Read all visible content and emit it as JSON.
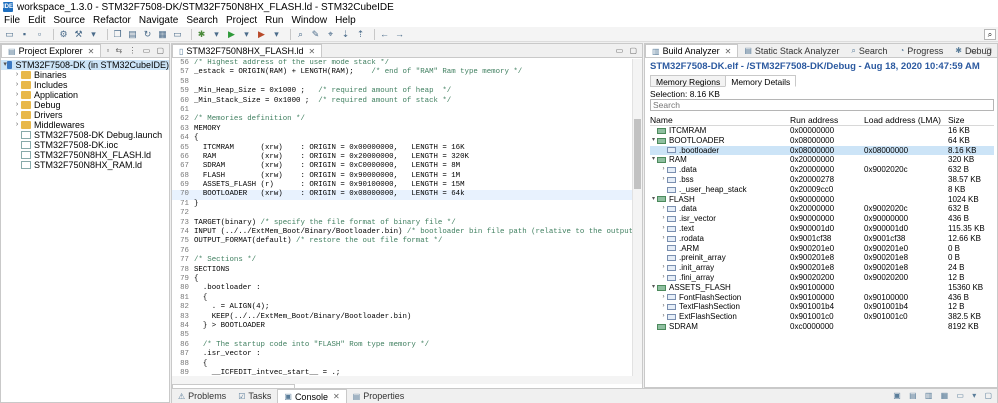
{
  "window": {
    "title": "workspace_1.3.0 - STM32F7508-DK/STM32F750N8HX_FLASH.ld - STM32CubeIDE",
    "icon": "IDE"
  },
  "menu": [
    "File",
    "Edit",
    "Source",
    "Refactor",
    "Navigate",
    "Search",
    "Project",
    "Run",
    "Window",
    "Help"
  ],
  "explorer": {
    "tab_label": "Project Explorer",
    "tree": [
      {
        "label": "STM32F7508-DK (in STM32CubeIDE)",
        "depth": 0,
        "expanded": true,
        "type": "project",
        "selected": true
      },
      {
        "label": "Binaries",
        "depth": 1,
        "type": "folder"
      },
      {
        "label": "Includes",
        "depth": 1,
        "type": "folder"
      },
      {
        "label": "Application",
        "depth": 1,
        "type": "folder"
      },
      {
        "label": "Debug",
        "depth": 1,
        "type": "folder"
      },
      {
        "label": "Drivers",
        "depth": 1,
        "type": "folder"
      },
      {
        "label": "Middlewares",
        "depth": 1,
        "type": "folder"
      },
      {
        "label": "STM32F7508-DK Debug.launch",
        "depth": 1,
        "type": "file"
      },
      {
        "label": "STM32F7508-DK.ioc",
        "depth": 1,
        "type": "file"
      },
      {
        "label": "STM32F750N8HX_FLASH.ld",
        "depth": 1,
        "type": "file"
      },
      {
        "label": "STM32F750N8HX_RAM.ld",
        "depth": 1,
        "type": "file"
      }
    ]
  },
  "editor": {
    "tab_label": "STM32F750N8HX_FLASH.ld",
    "bottom_tab": "STM32F750N8HX_FLASH.ld",
    "highlight_line": 70,
    "lines": [
      {
        "n": "56",
        "code": "/* Highest address of the user mode stack */"
      },
      {
        "n": "57",
        "code": "_estack = ORIGIN(RAM) + LENGTH(RAM);    /* end of \"RAM\" Ram type memory */"
      },
      {
        "n": "58",
        "code": ""
      },
      {
        "n": "59",
        "code": "_Min_Heap_Size = 0x1000 ;   /* required amount of heap  */"
      },
      {
        "n": "60",
        "code": "_Min_Stack_Size = 0x1000 ;  /* required amount of stack */"
      },
      {
        "n": "61",
        "code": ""
      },
      {
        "n": "62",
        "code": "/* Memories definition */"
      },
      {
        "n": "63",
        "code": "MEMORY"
      },
      {
        "n": "64",
        "code": "{"
      },
      {
        "n": "65",
        "code": "  ITCMRAM      (xrw)    : ORIGIN = 0x00000000,   LENGTH = 16K"
      },
      {
        "n": "66",
        "code": "  RAM          (xrw)    : ORIGIN = 0x20000000,   LENGTH = 320K"
      },
      {
        "n": "67",
        "code": "  SDRAM        (xrw)    : ORIGIN = 0xC0000000,   LENGTH = 8M"
      },
      {
        "n": "68",
        "code": "  FLASH        (xrw)    : ORIGIN = 0x90000000,   LENGTH = 1M"
      },
      {
        "n": "69",
        "code": "  ASSETS_FLASH (r)      : ORIGIN = 0x90100000,   LENGTH = 15M"
      },
      {
        "n": "70",
        "code": "  BOOTLOADER   (xrw)    : ORIGIN = 0x08000000,   LENGTH = 64k"
      },
      {
        "n": "71",
        "code": "}"
      },
      {
        "n": "72",
        "code": ""
      },
      {
        "n": "73",
        "code": "TARGET(binary) /* specify the file format of binary file */"
      },
      {
        "n": "74",
        "code": "INPUT (../../ExtMem_Boot/Binary/Bootloader.bin) /* bootloader bin file path (relative to the output folder)"
      },
      {
        "n": "75",
        "code": "OUTPUT_FORMAT(default) /* restore the out file format */"
      },
      {
        "n": "76",
        "code": ""
      },
      {
        "n": "77",
        "code": "/* Sections */"
      },
      {
        "n": "78",
        "code": "SECTIONS"
      },
      {
        "n": "79",
        "code": "{"
      },
      {
        "n": "80",
        "code": "  .bootloader :"
      },
      {
        "n": "81",
        "code": "  {"
      },
      {
        "n": "82",
        "code": "    . = ALIGN(4);"
      },
      {
        "n": "83",
        "code": "    KEEP(../../ExtMem_Boot/Binary/Bootloader.bin)"
      },
      {
        "n": "84",
        "code": "  } > BOOTLOADER"
      },
      {
        "n": "85",
        "code": ""
      },
      {
        "n": "86",
        "code": "  /* The startup code into \"FLASH\" Rom type memory */"
      },
      {
        "n": "87",
        "code": "  .isr_vector :"
      },
      {
        "n": "88",
        "code": "  {"
      },
      {
        "n": "89",
        "code": "    __ICFEDIT_intvec_start__ = .;"
      }
    ]
  },
  "analyzer": {
    "tabs": [
      "Build Analyzer",
      "Static Stack Analyzer",
      "Search",
      "Progress",
      "Debug"
    ],
    "title": "STM32F7508-DK.elf - /STM32F7508-DK/Debug - Aug 18, 2020 10:47:59 AM",
    "subtabs": [
      "Memory Regions",
      "Memory Details"
    ],
    "active_subtab": 1,
    "selection": "Selection: 8.16 KB",
    "search_placeholder": "Search",
    "columns": [
      "Name",
      "Run address (VMA)",
      "Load address (LMA)",
      "Size"
    ],
    "rows": [
      {
        "name": "ITCMRAM",
        "depth": 0,
        "kind": "region",
        "arrow": "",
        "vma": "0x00000000",
        "lma": "",
        "size": "16 KB"
      },
      {
        "name": "BOOTLOADER",
        "depth": 0,
        "kind": "region",
        "arrow": "▾",
        "vma": "0x08000000",
        "lma": "",
        "size": "64 KB"
      },
      {
        "name": ".bootloader",
        "depth": 1,
        "kind": "section",
        "arrow": "",
        "vma": "0x08000000",
        "lma": "0x08000000",
        "size": "8.16 KB",
        "selected": true
      },
      {
        "name": "RAM",
        "depth": 0,
        "kind": "region",
        "arrow": "▾",
        "vma": "0x20000000",
        "lma": "",
        "size": "320 KB"
      },
      {
        "name": ".data",
        "depth": 1,
        "kind": "section",
        "arrow": "›",
        "vma": "0x20000000",
        "lma": "0x9002020c",
        "size": "632 B"
      },
      {
        "name": ".bss",
        "depth": 1,
        "kind": "section",
        "arrow": "›",
        "vma": "0x20000278",
        "lma": "",
        "size": "38.57 KB"
      },
      {
        "name": "._user_heap_stack",
        "depth": 1,
        "kind": "section",
        "arrow": "",
        "vma": "0x20009cc0",
        "lma": "",
        "size": "8 KB"
      },
      {
        "name": "FLASH",
        "depth": 0,
        "kind": "region",
        "arrow": "▾",
        "vma": "0x90000000",
        "lma": "",
        "size": "1024 KB"
      },
      {
        "name": ".data",
        "depth": 1,
        "kind": "section",
        "arrow": "›",
        "vma": "0x20000000",
        "lma": "0x9002020c",
        "size": "632 B"
      },
      {
        "name": ".isr_vector",
        "depth": 1,
        "kind": "section",
        "arrow": "›",
        "vma": "0x90000000",
        "lma": "0x90000000",
        "size": "436 B"
      },
      {
        "name": ".text",
        "depth": 1,
        "kind": "section",
        "arrow": "›",
        "vma": "0x900001d0",
        "lma": "0x900001d0",
        "size": "115.35 KB"
      },
      {
        "name": ".rodata",
        "depth": 1,
        "kind": "section",
        "arrow": "›",
        "vma": "0x9001cf38",
        "lma": "0x9001cf38",
        "size": "12.66 KB"
      },
      {
        "name": ".ARM",
        "depth": 1,
        "kind": "section",
        "arrow": "",
        "vma": "0x900201e0",
        "lma": "0x900201e0",
        "size": "0 B"
      },
      {
        "name": ".preinit_array",
        "depth": 1,
        "kind": "section",
        "arrow": "",
        "vma": "0x900201e8",
        "lma": "0x900201e8",
        "size": "0 B"
      },
      {
        "name": ".init_array",
        "depth": 1,
        "kind": "section",
        "arrow": "›",
        "vma": "0x900201e8",
        "lma": "0x900201e8",
        "size": "24 B"
      },
      {
        "name": ".fini_array",
        "depth": 1,
        "kind": "section",
        "arrow": "›",
        "vma": "0x90020200",
        "lma": "0x90020200",
        "size": "12 B"
      },
      {
        "name": "ASSETS_FLASH",
        "depth": 0,
        "kind": "region",
        "arrow": "▾",
        "vma": "0x90100000",
        "lma": "",
        "size": "15360 KB"
      },
      {
        "name": "FontFlashSection",
        "depth": 1,
        "kind": "section",
        "arrow": "›",
        "vma": "0x90100000",
        "lma": "0x90100000",
        "size": "436 B"
      },
      {
        "name": "TextFlashSection",
        "depth": 1,
        "kind": "section",
        "arrow": "›",
        "vma": "0x901001b4",
        "lma": "0x901001b4",
        "size": "12 B"
      },
      {
        "name": "ExtFlashSection",
        "depth": 1,
        "kind": "section",
        "arrow": "›",
        "vma": "0x901001c0",
        "lma": "0x901001c0",
        "size": "382.5 KB"
      },
      {
        "name": "SDRAM",
        "depth": 0,
        "kind": "region",
        "arrow": "",
        "vma": "0xc0000000",
        "lma": "",
        "size": "8192 KB"
      }
    ]
  },
  "bottom": {
    "tabs": [
      "Problems",
      "Tasks",
      "Console",
      "Properties"
    ],
    "active": 2
  },
  "colors": {
    "title_blue": "#2c5aa0",
    "comment_green": "#3f7f5f",
    "selection": "#cce4f7"
  }
}
